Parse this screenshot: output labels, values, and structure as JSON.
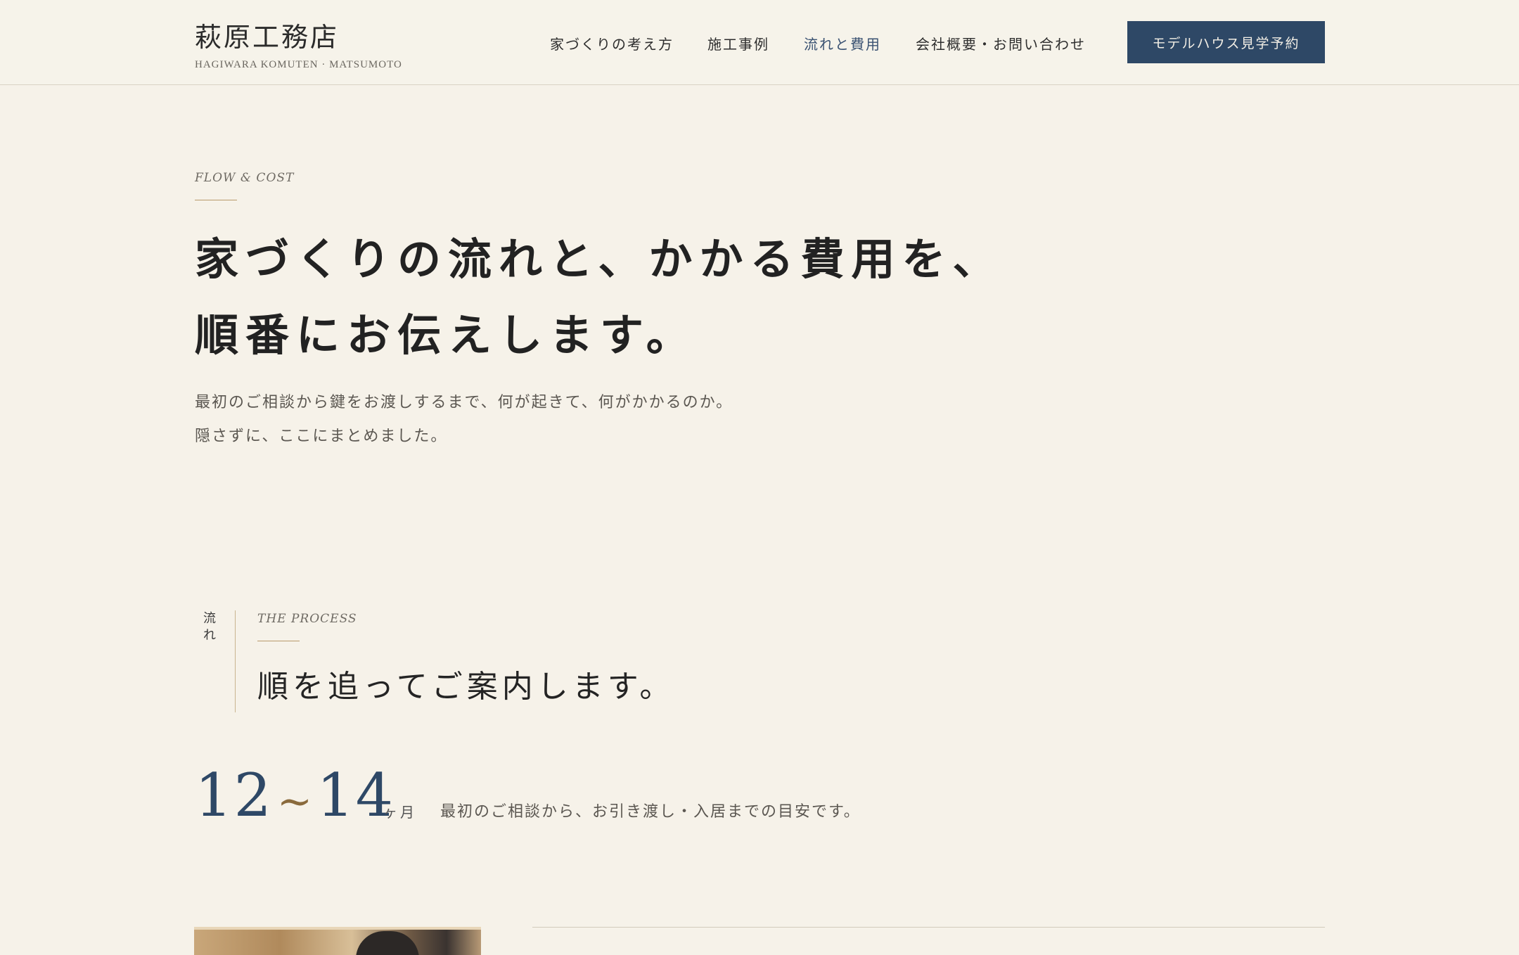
{
  "header": {
    "logo_name": "萩原工務店",
    "logo_sub": "HAGIWARA KOMUTEN · MATSUMOTO",
    "nav": [
      {
        "label": "家づくりの考え方",
        "active": false
      },
      {
        "label": "施工事例",
        "active": false
      },
      {
        "label": "流れと費用",
        "active": true
      },
      {
        "label": "会社概要・お問い合わせ",
        "active": false
      }
    ],
    "cta_label": "モデルハウス見学予約"
  },
  "hero": {
    "eyebrow": "FLOW & COST",
    "title_line1": "家づくりの流れと、かかる費用を、",
    "title_line2": "順番にお伝えします。",
    "body_line1": "最初のご相談から鍵をお渡しするまで、何が起きて、何がかかるのか。",
    "body_line2": "隠さずに、ここにまとめました。"
  },
  "process": {
    "side_label_1": "流",
    "side_label_2": "れ",
    "eyebrow": "THE PROCESS",
    "title": "順を追ってご案内します。",
    "duration_from": "12",
    "duration_sep": "~",
    "duration_to": "14",
    "duration_unit": "ヶ月",
    "duration_note": "最初のご相談から、お引き渡し・入居までの目安です。"
  },
  "colors": {
    "background": "#f6f2e9",
    "accent_navy": "#2e4866",
    "accent_gold": "#b89a6b",
    "nav_active": "#3a5272"
  }
}
